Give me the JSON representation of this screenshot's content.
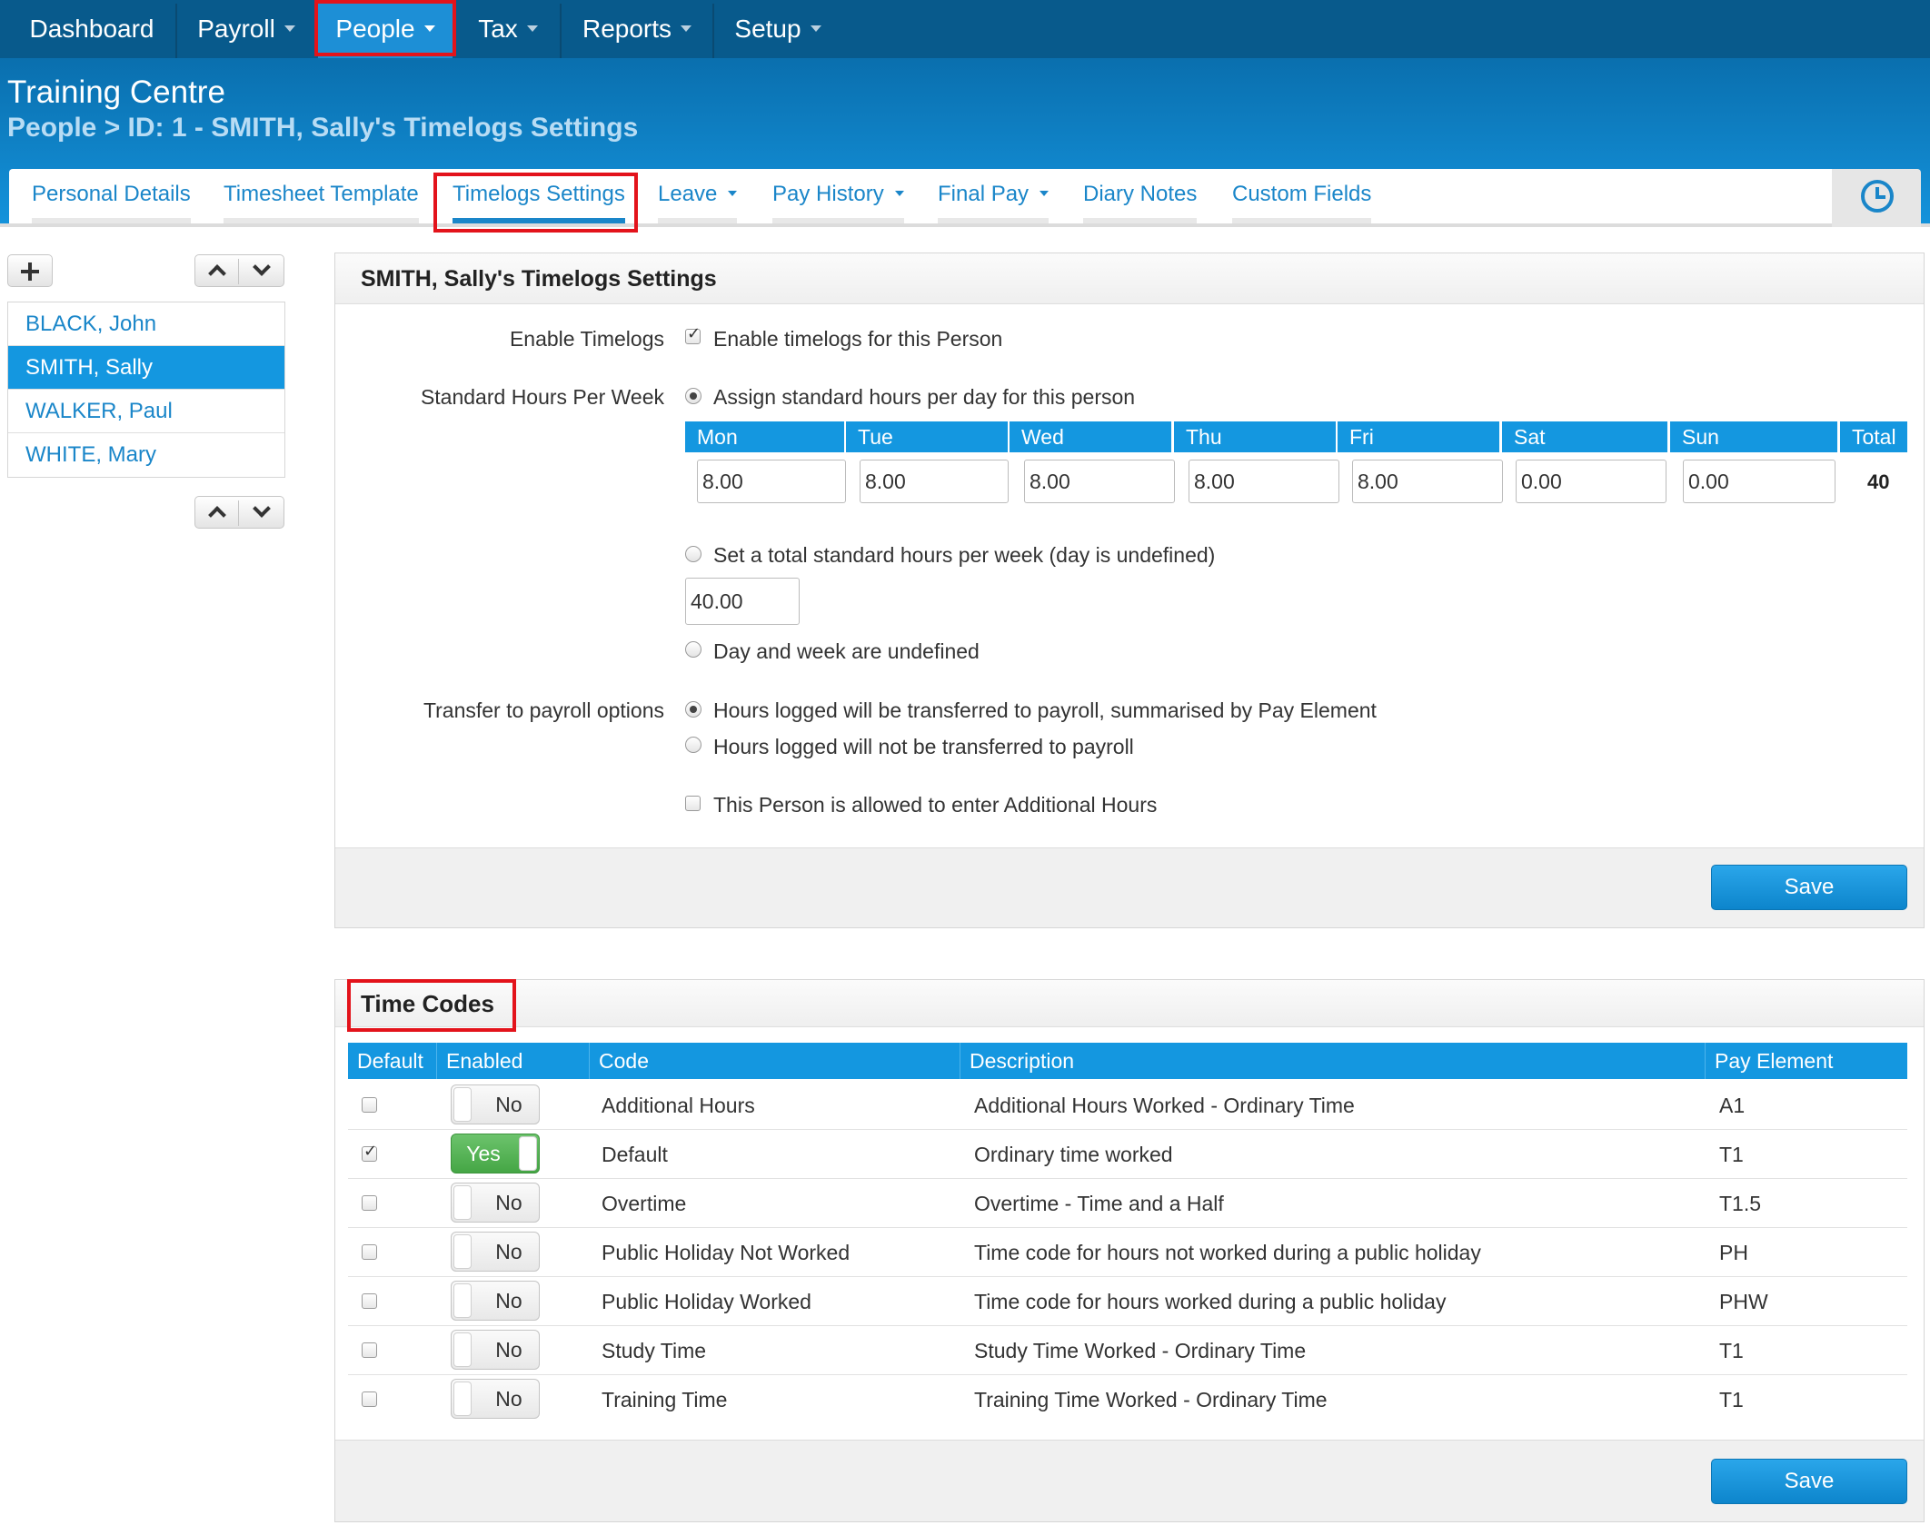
{
  "topnav": {
    "items": [
      {
        "label": "Dashboard"
      },
      {
        "label": "Payroll"
      },
      {
        "label": "People"
      },
      {
        "label": "Tax"
      },
      {
        "label": "Reports"
      },
      {
        "label": "Setup"
      }
    ],
    "active": "People"
  },
  "header": {
    "title": "Training Centre",
    "breadcrumb": "People > ID: 1 - SMITH, Sally's Timelogs Settings"
  },
  "tabs": [
    {
      "label": "Personal Details"
    },
    {
      "label": "Timesheet Template"
    },
    {
      "label": "Timelogs Settings"
    },
    {
      "label": "Leave"
    },
    {
      "label": "Pay History"
    },
    {
      "label": "Final Pay"
    },
    {
      "label": "Diary Notes"
    },
    {
      "label": "Custom Fields"
    }
  ],
  "active_tab": "Timelogs Settings",
  "sidebar": {
    "people": [
      {
        "name": "BLACK, John"
      },
      {
        "name": "SMITH, Sally"
      },
      {
        "name": "WALKER, Paul"
      },
      {
        "name": "WHITE, Mary"
      }
    ],
    "selected": "SMITH, Sally"
  },
  "settings": {
    "title": "SMITH, Sally's Timelogs Settings",
    "enable_label": "Enable Timelogs",
    "enable_text": "Enable timelogs for this Person",
    "enable_checked": true,
    "std_hours_label": "Standard Hours Per Week",
    "opt_per_day": "Assign standard hours per day for this person",
    "days": [
      {
        "day": "Mon",
        "value": "8.00"
      },
      {
        "day": "Tue",
        "value": "8.00"
      },
      {
        "day": "Wed",
        "value": "8.00"
      },
      {
        "day": "Thu",
        "value": "8.00"
      },
      {
        "day": "Fri",
        "value": "8.00"
      },
      {
        "day": "Sat",
        "value": "0.00"
      },
      {
        "day": "Sun",
        "value": "0.00"
      }
    ],
    "total_label": "Total",
    "total_value": "40",
    "opt_total": "Set a total standard hours per week (day is undefined)",
    "total_week_value": "40.00",
    "opt_undefined": "Day and week are undefined",
    "transfer_label": "Transfer to payroll options",
    "transfer_opt1": "Hours logged will be transferred to payroll, summarised by Pay Element",
    "transfer_opt2": "Hours logged will not be transferred to payroll",
    "additional_hours": "This Person is allowed to enter Additional Hours",
    "save_label": "Save"
  },
  "time_codes": {
    "title": "Time Codes",
    "columns": [
      "Default",
      "Enabled",
      "Code",
      "Description",
      "Pay Element"
    ],
    "rows": [
      {
        "default": false,
        "enabled": "No",
        "code": "Additional Hours",
        "description": "Additional Hours Worked - Ordinary Time",
        "pay_element": "A1"
      },
      {
        "default": true,
        "enabled": "Yes",
        "code": "Default",
        "description": "Ordinary time worked",
        "pay_element": "T1"
      },
      {
        "default": false,
        "enabled": "No",
        "code": "Overtime",
        "description": "Overtime - Time and a Half",
        "pay_element": "T1.5"
      },
      {
        "default": false,
        "enabled": "No",
        "code": "Public Holiday Not Worked",
        "description": "Time code for hours not worked during a public holiday",
        "pay_element": "PH"
      },
      {
        "default": false,
        "enabled": "No",
        "code": "Public Holiday Worked",
        "description": "Time code for hours worked during a public holiday",
        "pay_element": "PHW"
      },
      {
        "default": false,
        "enabled": "No",
        "code": "Study Time",
        "description": "Study Time Worked - Ordinary Time",
        "pay_element": "T1"
      },
      {
        "default": false,
        "enabled": "No",
        "code": "Training Time",
        "description": "Training Time Worked - Ordinary Time",
        "pay_element": "T1"
      }
    ],
    "save_label": "Save"
  },
  "colors": {
    "nav_bg": "#085a8c",
    "accent": "#1497e0",
    "highlight_box": "#e3131b",
    "toggle_on": "#45a645"
  }
}
